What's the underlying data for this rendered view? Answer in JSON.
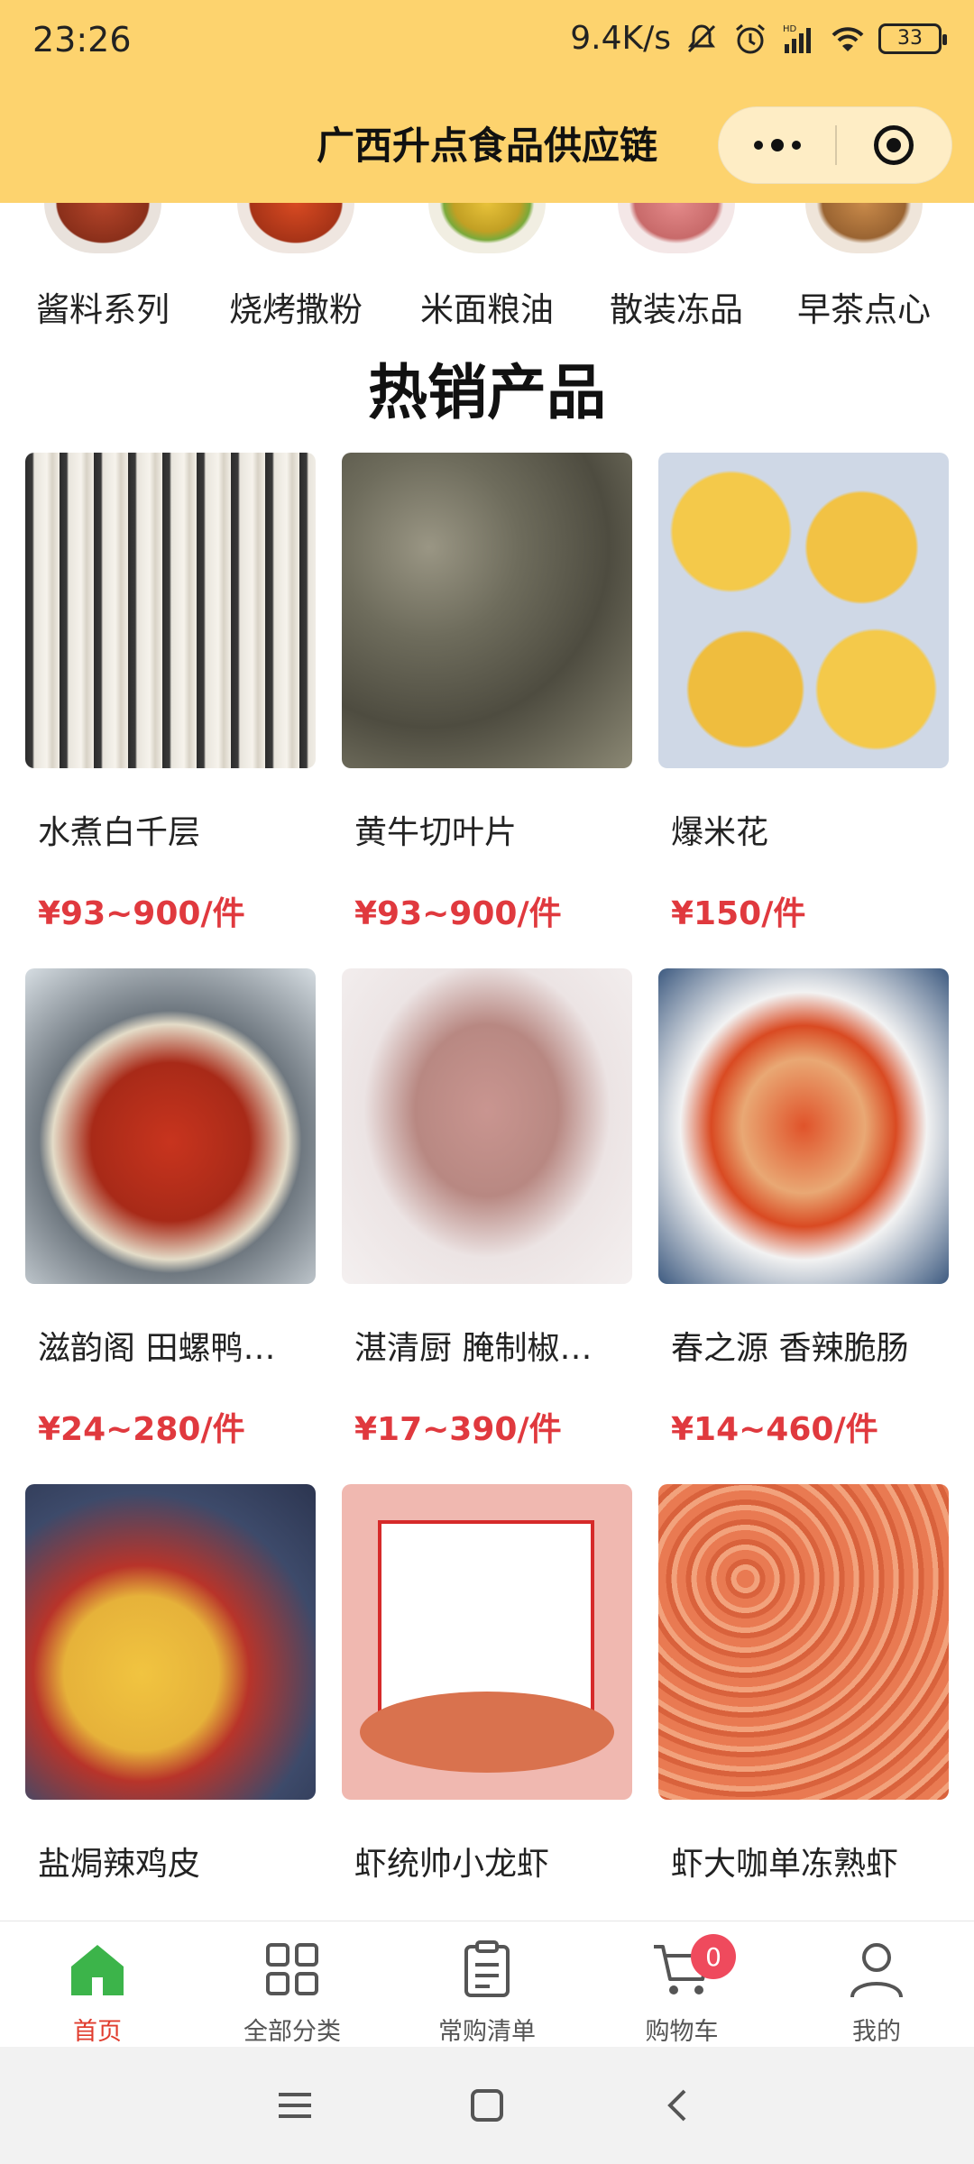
{
  "status_bar": {
    "time": "23:26",
    "network_speed": "9.4K/s",
    "battery": "33",
    "icons": [
      "mute-icon",
      "alarm-icon",
      "signal-icon",
      "wifi-icon",
      "battery-icon"
    ]
  },
  "header": {
    "title": "广西升点食品供应链",
    "capsule_icons": [
      "more-icon",
      "close-miniprogram-icon"
    ],
    "background_color": "#fdd36e"
  },
  "categories": [
    {
      "label": "酱料系列"
    },
    {
      "label": "烧烤撒粉"
    },
    {
      "label": "米面粮油"
    },
    {
      "label": "散装冻品"
    },
    {
      "label": "早茶点心"
    }
  ],
  "section_title": "热销产品",
  "products": [
    {
      "name": "水煮白千层",
      "price": "¥93~900/件"
    },
    {
      "name": "黄牛切叶片",
      "price": "¥93~900/件"
    },
    {
      "name": "爆米花",
      "price": "¥150/件"
    },
    {
      "name": "滋韵阁 田螺鸭…",
      "price": "¥24~280/件"
    },
    {
      "name": "湛清厨 腌制椒…",
      "price": "¥17~390/件"
    },
    {
      "name": "春之源 香辣脆肠",
      "price": "¥14~460/件"
    },
    {
      "name": "盐焗辣鸡皮",
      "price": ""
    },
    {
      "name": "虾统帅小龙虾",
      "price": ""
    },
    {
      "name": "虾大咖单冻熟虾",
      "price": ""
    }
  ],
  "tabbar": {
    "items": [
      {
        "label": "首页",
        "icon": "home-icon",
        "active": true
      },
      {
        "label": "全部分类",
        "icon": "grid-icon",
        "active": false
      },
      {
        "label": "常购清单",
        "icon": "list-icon",
        "active": false
      },
      {
        "label": "购物车",
        "icon": "cart-icon",
        "active": false,
        "badge": "0"
      },
      {
        "label": "我的",
        "icon": "user-icon",
        "active": false
      }
    ],
    "active_color": "#e03c2e",
    "home_icon_color": "#3cb44a"
  },
  "price_color": "#e0393e"
}
